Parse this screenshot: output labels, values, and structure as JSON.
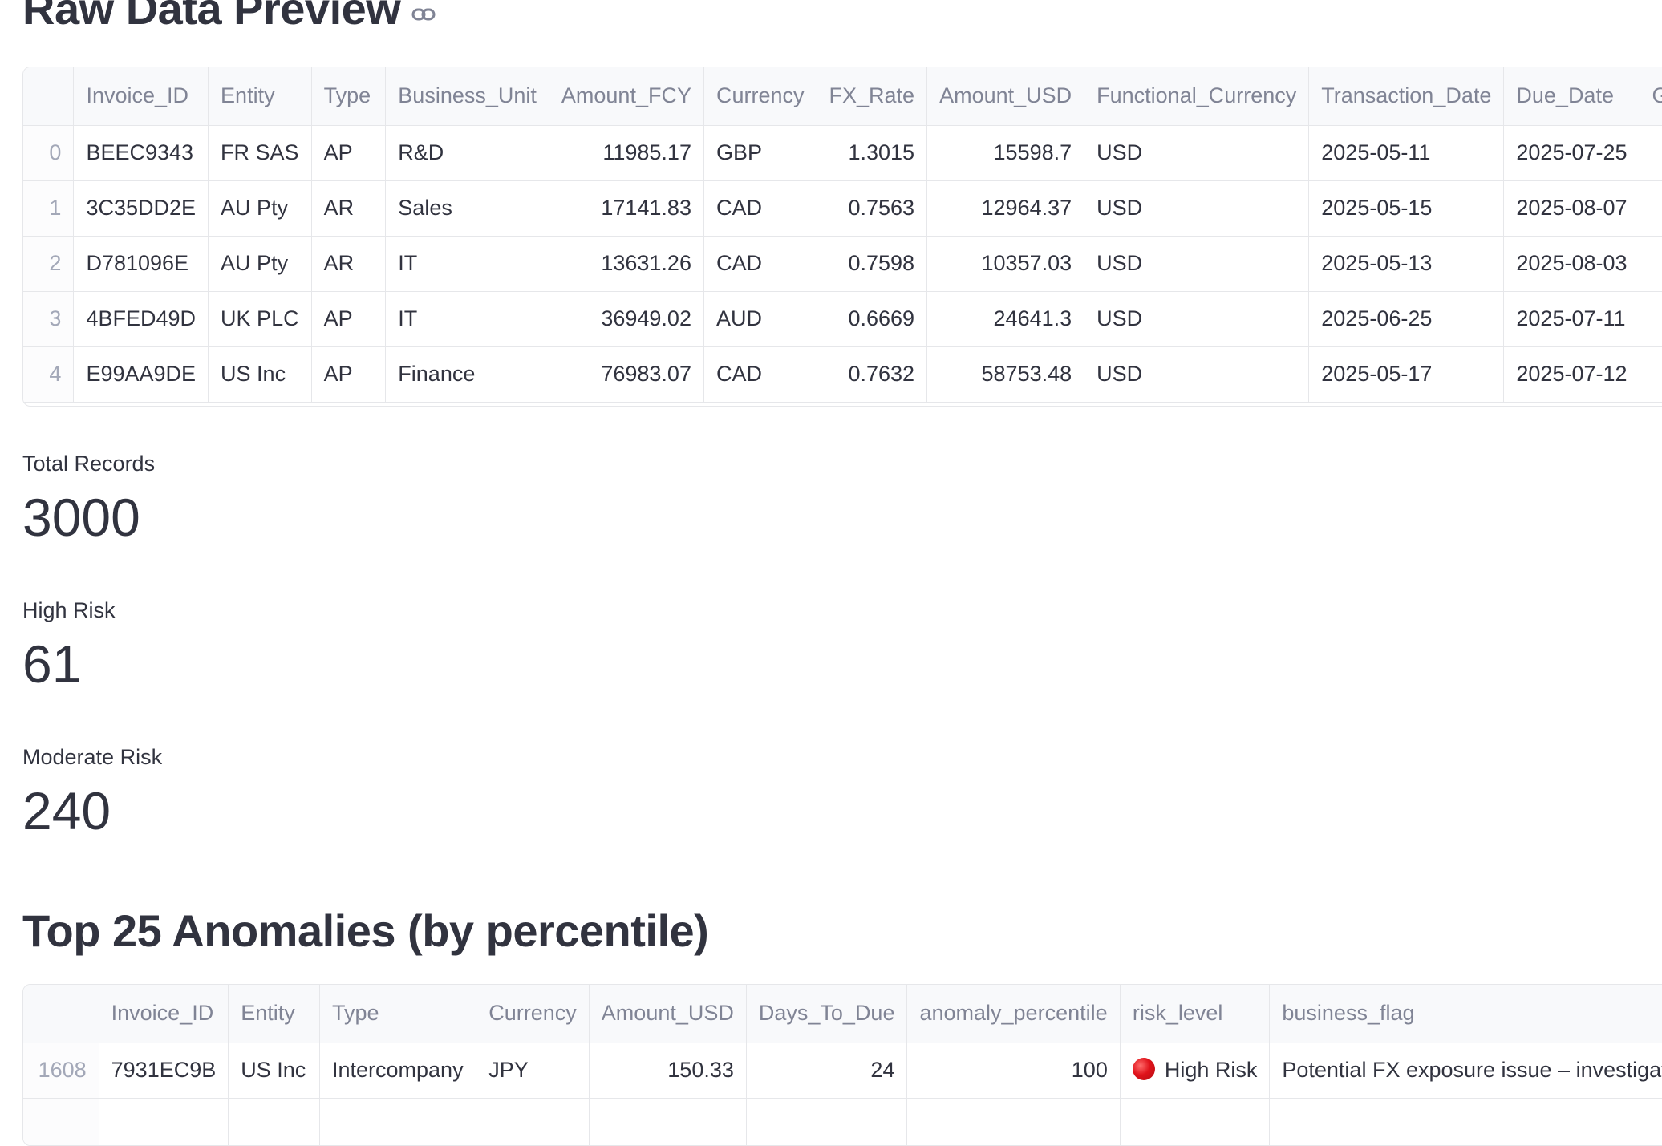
{
  "raw_preview": {
    "title": "Raw Data Preview",
    "columns": [
      "",
      "Invoice_ID",
      "Entity",
      "Type",
      "Business_Unit",
      "Amount_FCY",
      "Currency",
      "FX_Rate",
      "Amount_USD",
      "Functional_Currency",
      "Transaction_Date",
      "Due_Date",
      "GL_"
    ],
    "rows": [
      [
        "0",
        "BEEC9343",
        "FR SAS",
        "AP",
        "R&D",
        "11985.17",
        "GBP",
        "1.3015",
        "15598.7",
        "USD",
        "2025-05-11",
        "2025-07-25",
        ""
      ],
      [
        "1",
        "3C35DD2E",
        "AU Pty",
        "AR",
        "Sales",
        "17141.83",
        "CAD",
        "0.7563",
        "12964.37",
        "USD",
        "2025-05-15",
        "2025-08-07",
        ""
      ],
      [
        "2",
        "D781096E",
        "AU Pty",
        "AR",
        "IT",
        "13631.26",
        "CAD",
        "0.7598",
        "10357.03",
        "USD",
        "2025-05-13",
        "2025-08-03",
        ""
      ],
      [
        "3",
        "4BFED49D",
        "UK PLC",
        "AP",
        "IT",
        "36949.02",
        "AUD",
        "0.6669",
        "24641.3",
        "USD",
        "2025-06-25",
        "2025-07-11",
        ""
      ],
      [
        "4",
        "E99AA9DE",
        "US Inc",
        "AP",
        "Finance",
        "76983.07",
        "CAD",
        "0.7632",
        "58753.48",
        "USD",
        "2025-05-17",
        "2025-07-12",
        ""
      ]
    ]
  },
  "metrics": {
    "total_records": {
      "label": "Total Records",
      "value": "3000"
    },
    "high_risk": {
      "label": "High Risk",
      "value": "61"
    },
    "moderate_risk": {
      "label": "Moderate Risk",
      "value": "240"
    }
  },
  "anomalies": {
    "title": "Top 25 Anomalies (by percentile)",
    "columns": [
      "",
      "Invoice_ID",
      "Entity",
      "Type",
      "Currency",
      "Amount_USD",
      "Days_To_Due",
      "anomaly_percentile",
      "risk_level",
      "business_flag"
    ],
    "rows": [
      [
        "1608",
        "7931EC9B",
        "US Inc",
        "Intercompany",
        "JPY",
        "150.33",
        "24",
        "100",
        "High Risk",
        "Potential FX exposure issue – investigate i"
      ],
      [
        "",
        "",
        "",
        "",
        "",
        "",
        "",
        "",
        "",
        ""
      ]
    ]
  },
  "colors": {
    "risk_dot": "#e0131b",
    "header_bg": "#f8f9fb",
    "border": "#e6e7ea"
  }
}
